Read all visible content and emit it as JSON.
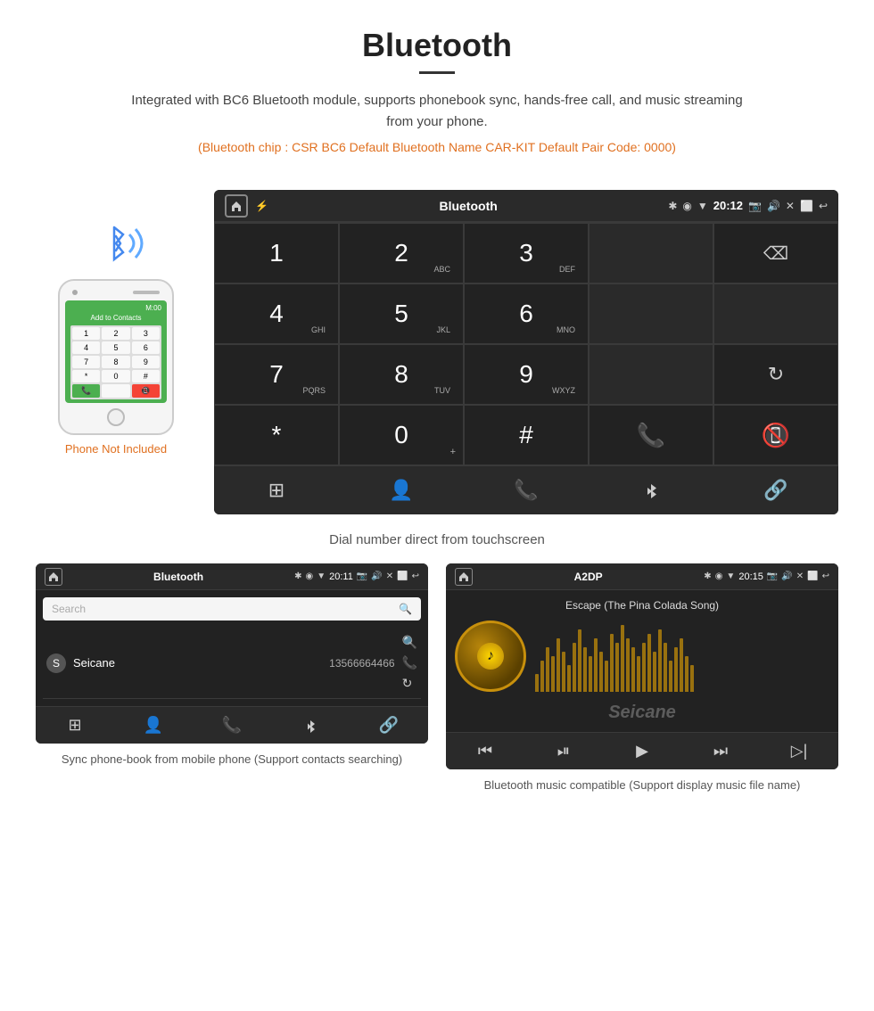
{
  "header": {
    "title": "Bluetooth",
    "description": "Integrated with BC6 Bluetooth module, supports phonebook sync, hands-free call, and music streaming from your phone.",
    "specs": "(Bluetooth chip : CSR BC6   Default Bluetooth Name CAR-KIT    Default Pair Code: 0000)"
  },
  "phone_mockup": {
    "not_included_label": "Phone Not Included",
    "screen_label": "Add to Contacts",
    "keys": [
      "1",
      "2",
      "3",
      "4",
      "5",
      "6",
      "7",
      "8",
      "9",
      "*",
      "0",
      "#"
    ]
  },
  "dial_screen": {
    "title": "Bluetooth",
    "time": "20:12",
    "keys": [
      {
        "num": "1",
        "sub": ""
      },
      {
        "num": "2",
        "sub": "ABC"
      },
      {
        "num": "3",
        "sub": "DEF"
      },
      {
        "num": "",
        "sub": ""
      },
      {
        "num": "⌫",
        "sub": ""
      },
      {
        "num": "4",
        "sub": "GHI"
      },
      {
        "num": "5",
        "sub": "JKL"
      },
      {
        "num": "6",
        "sub": "MNO"
      },
      {
        "num": "",
        "sub": ""
      },
      {
        "num": "",
        "sub": ""
      },
      {
        "num": "7",
        "sub": "PQRS"
      },
      {
        "num": "8",
        "sub": "TUV"
      },
      {
        "num": "9",
        "sub": "WXYZ"
      },
      {
        "num": "",
        "sub": ""
      },
      {
        "num": "↻",
        "sub": ""
      },
      {
        "num": "*",
        "sub": ""
      },
      {
        "num": "0",
        "sub": "+"
      },
      {
        "num": "#",
        "sub": ""
      },
      {
        "num": "☎",
        "sub": ""
      },
      {
        "num": "☎",
        "sub": ""
      }
    ],
    "bottom_nav": [
      "⊞",
      "👤",
      "📞",
      "✱",
      "🔗"
    ],
    "caption": "Dial number direct from touchscreen"
  },
  "phonebook_screen": {
    "title": "Bluetooth",
    "time": "20:11",
    "search_placeholder": "Search",
    "contacts": [
      {
        "initial": "S",
        "name": "Seicane",
        "number": "13566664466"
      }
    ],
    "sidebar_icons": [
      "🔍",
      "📞",
      "↻"
    ],
    "bottom_nav": [
      "⊞",
      "👤",
      "📞",
      "✱",
      "🔗"
    ],
    "caption": "Sync phone-book from mobile phone\n(Support contacts searching)"
  },
  "music_screen": {
    "title": "A2DP",
    "time": "20:15",
    "song_title": "Escape (The Pina Colada Song)",
    "bottom_nav": [
      "⏮",
      "⏭",
      "▶",
      "⏭",
      "▷|"
    ],
    "caption": "Bluetooth music compatible\n(Support display music file name)"
  },
  "seicane_watermark": "Seicane"
}
